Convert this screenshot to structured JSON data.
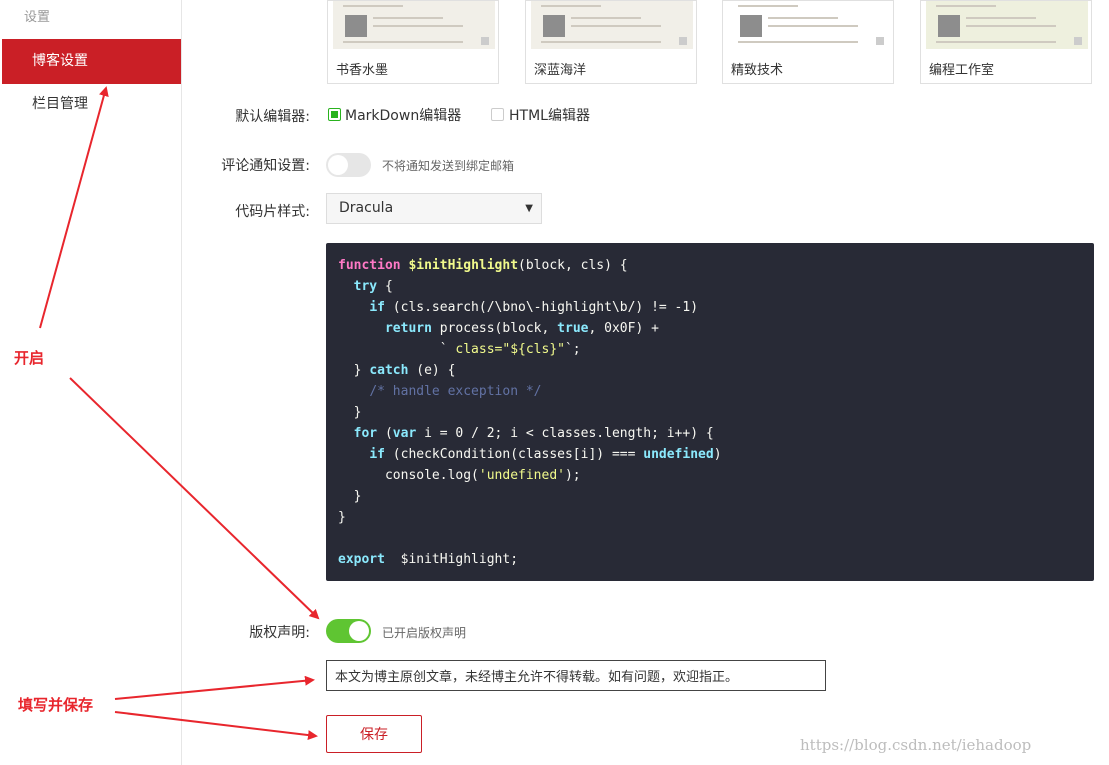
{
  "sidebar": {
    "title": "设置",
    "items": [
      {
        "label": "博客设置",
        "active": true
      },
      {
        "label": "栏目管理",
        "active": false
      }
    ]
  },
  "themes": [
    {
      "label": "书香水墨"
    },
    {
      "label": "深蓝海洋"
    },
    {
      "label": "精致技术"
    },
    {
      "label": "编程工作室"
    }
  ],
  "editor": {
    "label": "默认编辑器:",
    "options": [
      {
        "label": "MarkDown编辑器",
        "checked": true
      },
      {
        "label": "HTML编辑器",
        "checked": false
      }
    ]
  },
  "comment_notify": {
    "label": "评论通知设置:",
    "enabled": false,
    "hint": "不将通知发送到绑定邮箱"
  },
  "code_style": {
    "label": "代码片样式:",
    "selected": "Dracula"
  },
  "code_sample": [
    "function $initHighlight(block, cls) {",
    "  try {",
    "    if (cls.search(/\\bno\\-highlight\\b/) != -1)",
    "      return process(block, true, 0x0F) +",
    "             ` class=\"${cls}\"`;",
    "  } catch (e) {",
    "    /* handle exception */",
    "  }",
    "  for (var i = 0 / 2; i < classes.length; i++) {",
    "    if (checkCondition(classes[i]) === undefined)",
    "      console.log('undefined');",
    "  }",
    "}",
    "",
    "export  $initHighlight;"
  ],
  "copyright": {
    "label": "版权声明:",
    "enabled": true,
    "hint": "已开启版权声明",
    "text_value": "本文为博主原创文章，未经博主允许不得转载。如有问题，欢迎指正。"
  },
  "save_label": "保存",
  "annotations": {
    "open": "开启",
    "fill_save": "填写并保存",
    "color": "#e8262d"
  },
  "watermark": "https://blog.csdn.net/iehadoop",
  "colors": {
    "brand": "#ca1f26",
    "toggle_on": "#5fc532",
    "checkbox_on": "#29b21e",
    "code_bg": "#282a36"
  }
}
